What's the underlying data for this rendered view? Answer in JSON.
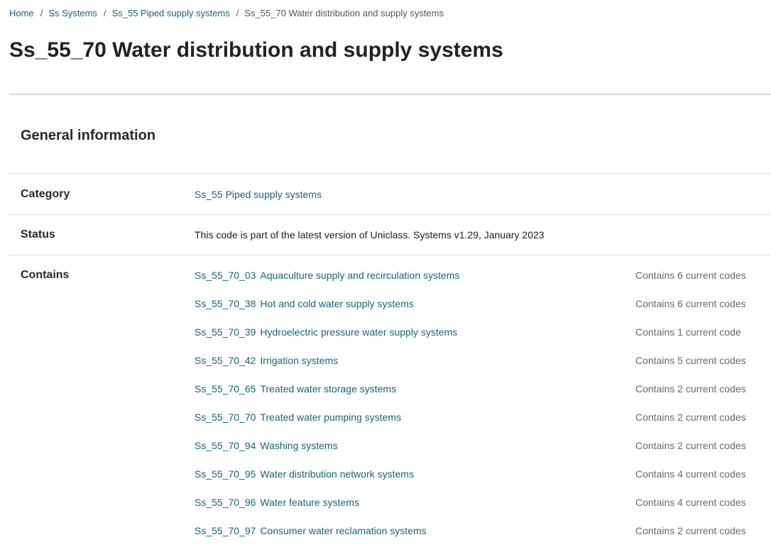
{
  "breadcrumb": {
    "items": [
      {
        "label": "Home"
      },
      {
        "label": "Ss  Systems"
      },
      {
        "label": "Ss_55  Piped supply systems"
      }
    ],
    "separator": "/",
    "current": "Ss_55_70  Water distribution and supply systems"
  },
  "page": {
    "title": "Ss_55_70  Water distribution and supply systems"
  },
  "general": {
    "heading": "General information",
    "category_label": "Category",
    "category_value": "Ss_55  Piped supply systems",
    "status_label": "Status",
    "status_value": "This code is part of the latest version of Uniclass. Systems v1.29, January 2023",
    "contains_label": "Contains",
    "contains": [
      {
        "code": "Ss_55_70_03",
        "name": "Aquaculture supply and recirculation systems",
        "count": "Contains 6 current codes"
      },
      {
        "code": "Ss_55_70_38",
        "name": "Hot and cold water supply systems",
        "count": "Contains 6 current codes"
      },
      {
        "code": "Ss_55_70_39",
        "name": "Hydroelectric pressure water supply systems",
        "count": "Contains 1 current code"
      },
      {
        "code": "Ss_55_70_42",
        "name": "Irrigation systems",
        "count": "Contains 5 current codes"
      },
      {
        "code": "Ss_55_70_65",
        "name": "Treated water storage systems",
        "count": "Contains 2 current codes"
      },
      {
        "code": "Ss_55_70_70",
        "name": "Treated water pumping systems",
        "count": "Contains 2 current codes"
      },
      {
        "code": "Ss_55_70_94",
        "name": "Washing systems",
        "count": "Contains 2 current codes"
      },
      {
        "code": "Ss_55_70_95",
        "name": "Water distribution network systems",
        "count": "Contains 4 current codes"
      },
      {
        "code": "Ss_55_70_96",
        "name": "Water feature systems",
        "count": "Contains 4 current codes"
      },
      {
        "code": "Ss_55_70_97",
        "name": "Consumer water reclamation systems",
        "count": "Contains 2 current codes"
      }
    ]
  },
  "colors": {
    "link": "#1a6477",
    "text": "#222222",
    "muted": "#6a6a6a",
    "divider": "#dcdcdc"
  }
}
